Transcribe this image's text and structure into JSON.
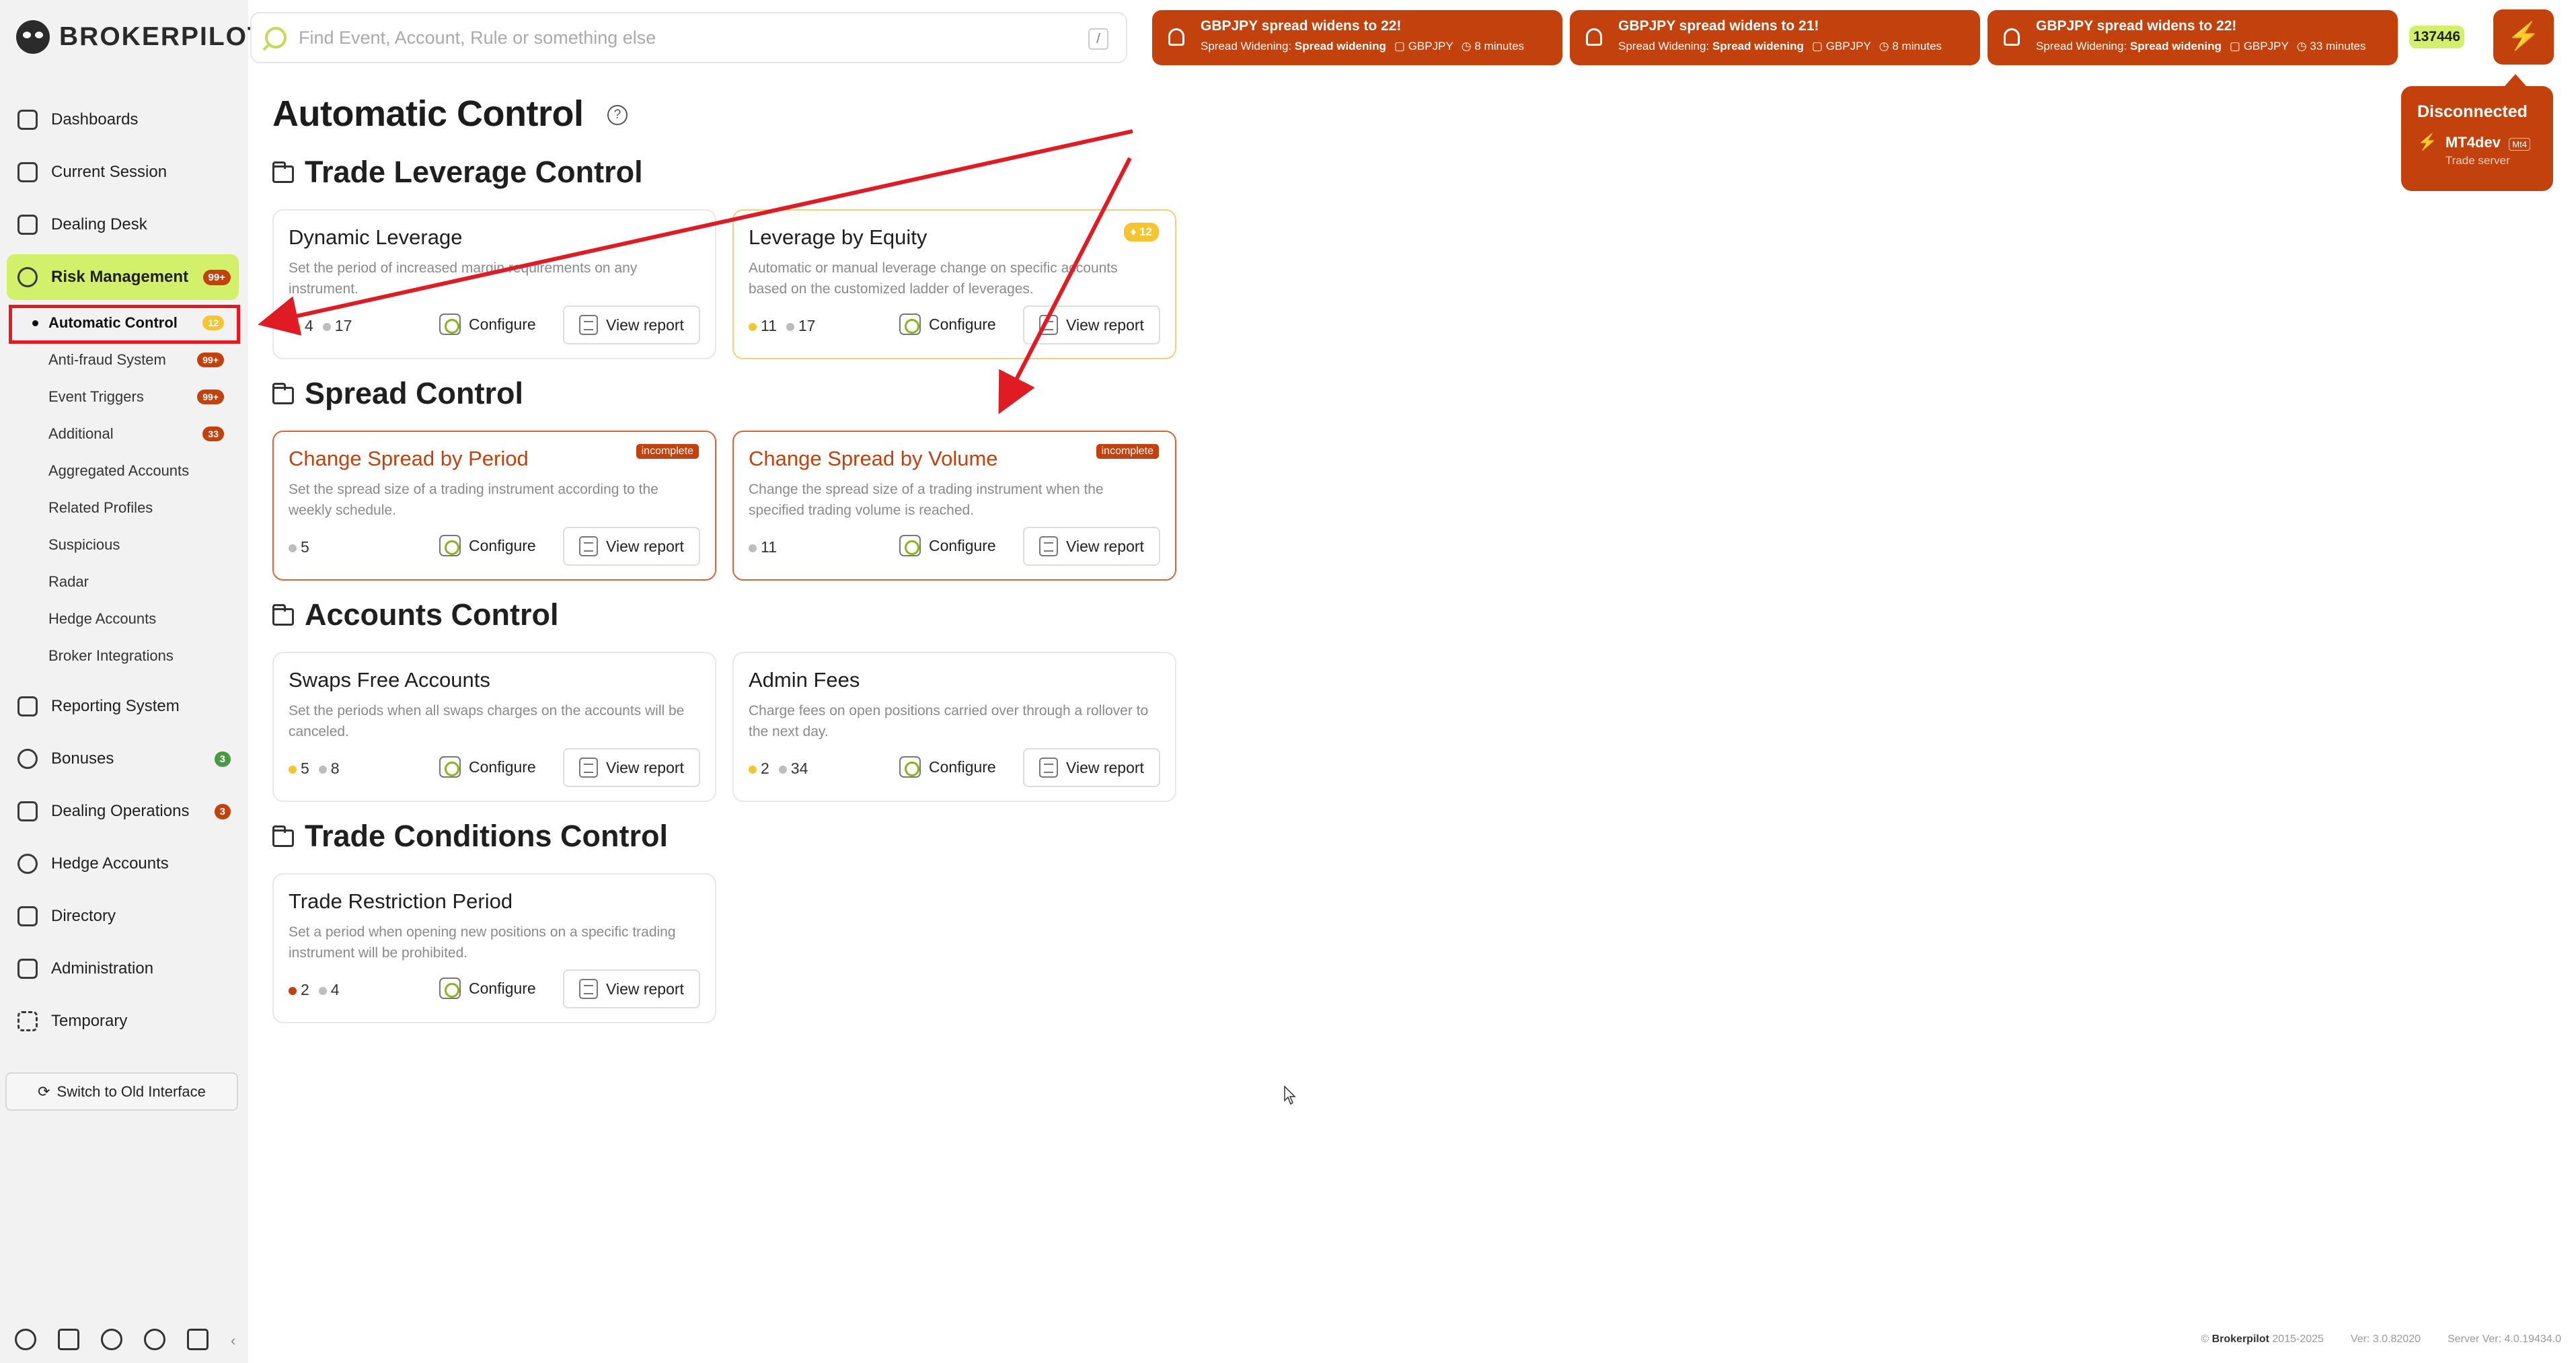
{
  "app": {
    "brand": "BROKERPILOT"
  },
  "search": {
    "placeholder": "Find Event, Account, Rule or something else",
    "shortcut": "/"
  },
  "notifications": [
    {
      "title": "GBPJPY spread widens to 22!",
      "category": "Spread Widening:",
      "type": "Spread widening",
      "symbol": "GBPJPY",
      "time": "8 minutes"
    },
    {
      "title": "GBPJPY spread widens to 21!",
      "category": "Spread Widening:",
      "type": "Spread widening",
      "symbol": "GBPJPY",
      "time": "8 minutes"
    },
    {
      "title": "GBPJPY spread widens to 22!",
      "category": "Spread Widening:",
      "type": "Spread widening",
      "symbol": "GBPJPY",
      "time": "33 minutes"
    }
  ],
  "header": {
    "id_badge": "137446",
    "connection": {
      "status": "Disconnected",
      "server_name": "MT4dev",
      "server_tag": "Mt4",
      "server_desc": "Trade server"
    }
  },
  "sidebar": {
    "items": [
      {
        "label": "Dashboards",
        "icon": "dashboard-icon"
      },
      {
        "label": "Current Session",
        "icon": "chart-line-icon"
      },
      {
        "label": "Dealing Desk",
        "icon": "desk-icon"
      },
      {
        "label": "Risk Management",
        "icon": "gauge-icon",
        "badge": "99+",
        "active": true
      },
      {
        "label": "Reporting System",
        "icon": "clipboard-icon"
      },
      {
        "label": "Bonuses",
        "icon": "gift-icon",
        "badge": "3"
      },
      {
        "label": "Dealing Operations",
        "icon": "calendar-icon",
        "badge": "3"
      },
      {
        "label": "Hedge Accounts",
        "icon": "hedge-icon"
      },
      {
        "label": "Directory",
        "icon": "book-icon"
      },
      {
        "label": "Administration",
        "icon": "shield-icon"
      },
      {
        "label": "Temporary",
        "icon": "dashed-square-icon"
      }
    ],
    "risk_sub": [
      {
        "label": "Automatic Control",
        "badge": "12",
        "current": true
      },
      {
        "label": "Anti-fraud System",
        "badge": "99+"
      },
      {
        "label": "Event Triggers",
        "badge": "99+"
      },
      {
        "label": "Additional",
        "badge": "33"
      },
      {
        "label": "Aggregated Accounts"
      },
      {
        "label": "Related Profiles"
      },
      {
        "label": "Suspicious"
      },
      {
        "label": "Radar"
      },
      {
        "label": "Hedge Accounts"
      },
      {
        "label": "Broker Integrations"
      }
    ],
    "switch_label": "Switch to Old Interface"
  },
  "page": {
    "title": "Automatic Control",
    "help": "?"
  },
  "actions": {
    "configure": "Configure",
    "view_report": "View report"
  },
  "sections": [
    {
      "title": "Trade Leverage Control",
      "cards": [
        {
          "title": "Dynamic Leverage",
          "desc": "Set the period of increased margin requirements on any instrument.",
          "stat_a": "4",
          "stat_b": "17"
        },
        {
          "title": "Leverage by Equity",
          "desc": "Automatic or manual leverage change on specific accounts based on the customized ladder of leverages.",
          "stat_a": "11",
          "stat_b": "17",
          "badge": "12"
        }
      ]
    },
    {
      "title": "Spread Control",
      "cards": [
        {
          "title": "Change Spread by Period",
          "desc": "Set the spread size of a trading instrument according to the weekly schedule.",
          "stat_a": "5",
          "badge": "incomplete"
        },
        {
          "title": "Change Spread by Volume",
          "desc": "Change the spread size of a trading instrument when the specified trading volume is reached.",
          "stat_a": "11",
          "badge": "incomplete"
        }
      ]
    },
    {
      "title": "Accounts Control",
      "cards": [
        {
          "title": "Swaps Free Accounts",
          "desc": "Set the periods when all swaps charges on the accounts will be canceled.",
          "stat_a": "5",
          "stat_b": "8"
        },
        {
          "title": "Admin Fees",
          "desc": "Charge fees on open positions carried over through a rollover to the next day.",
          "stat_a": "2",
          "stat_b": "34"
        }
      ]
    },
    {
      "title": "Trade Conditions Control",
      "cards": [
        {
          "title": "Trade Restriction Period",
          "desc": "Set a period when opening new positions on a specific trading instrument will be prohibited.",
          "stat_a": "2",
          "stat_b": "4"
        }
      ]
    }
  ],
  "footer": {
    "copyright": "©",
    "brand": "Brokerpilot",
    "years": "2015-2025",
    "version": "Ver: 3.0.82020",
    "server_version": "Server Ver: 4.0.19434.0"
  },
  "colors": {
    "accent": "#d3f06a",
    "alert": "#c2410c",
    "warning": "#f4c531",
    "annotation": "#e01b24"
  }
}
